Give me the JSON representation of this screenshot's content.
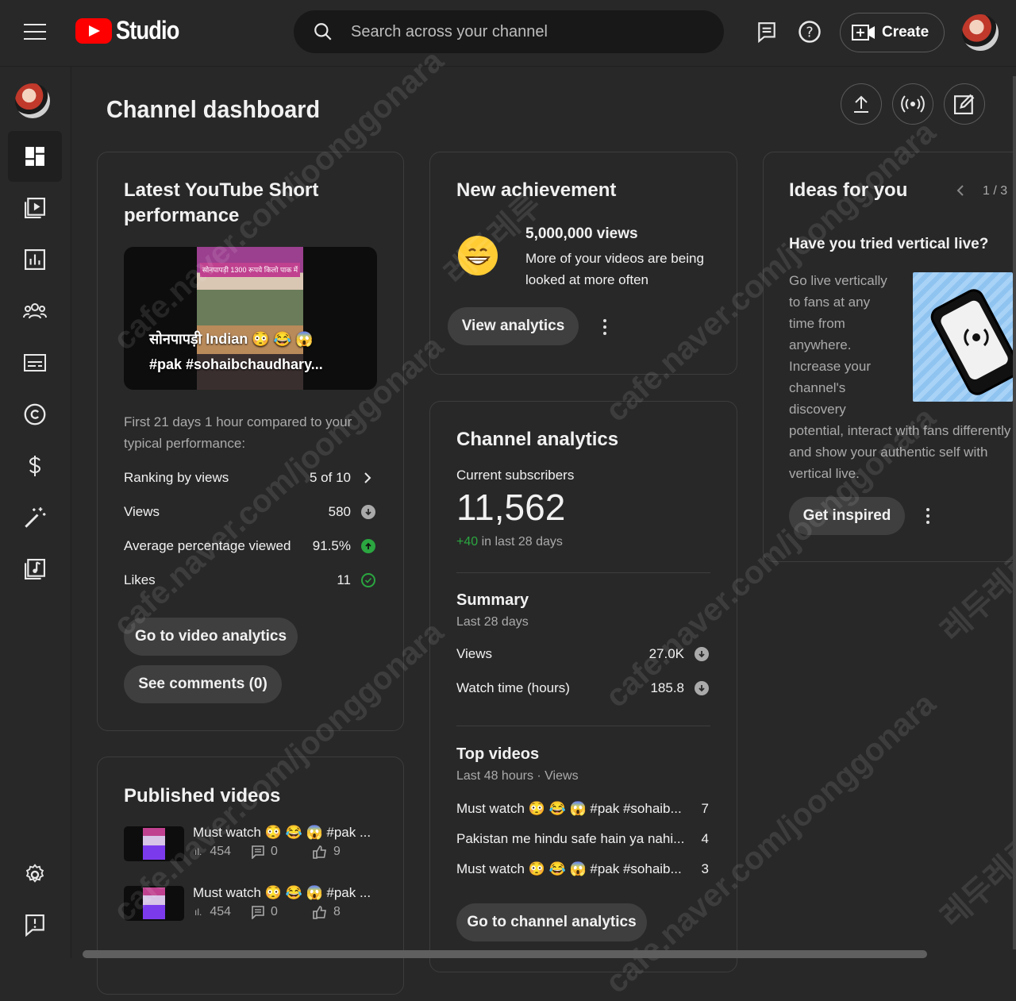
{
  "app": {
    "logo_text": "Studio"
  },
  "topbar": {
    "search_placeholder": "Search across your channel",
    "create_label": "Create"
  },
  "page": {
    "title": "Channel dashboard"
  },
  "short_card": {
    "title": "Latest YouTube Short performance",
    "thumb_band_text": "सोनपापड़ी 1300 रूपये किलो पाक में",
    "thumb_line1": "सोनपापड़ी Indian 😳 😂 😱",
    "thumb_line2": "#pak #sohaibchaudhary...",
    "comparison_text": "First 21 days 1 hour compared to your typical performance:",
    "rows": [
      {
        "label": "Ranking by views",
        "value": "5 of 10",
        "indicator": "chevron"
      },
      {
        "label": "Views",
        "value": "580",
        "indicator": "down-grey"
      },
      {
        "label": "Average percentage viewed",
        "value": "91.5%",
        "indicator": "up-green"
      },
      {
        "label": "Likes",
        "value": "11",
        "indicator": "check-green"
      }
    ],
    "btn_analytics": "Go to video analytics",
    "btn_comments": "See comments (0)"
  },
  "published": {
    "title": "Published videos",
    "items": [
      {
        "title": "Must watch 😳 😂 😱 #pak ...",
        "views": "454",
        "comments": "0",
        "likes": "9"
      },
      {
        "title": "Must watch 😳 😂 😱 #pak ...",
        "views": "454",
        "comments": "0",
        "likes": "8"
      }
    ]
  },
  "achievement": {
    "title": "New achievement",
    "milestone": "5,000,000 views",
    "description": "More of your videos are being looked at more often",
    "button": "View analytics"
  },
  "analytics": {
    "title": "Channel analytics",
    "subs_label": "Current subscribers",
    "subs_value": "11,562",
    "subs_delta": "+40",
    "subs_delta_suffix": "in last 28 days",
    "summary_title": "Summary",
    "summary_period": "Last 28 days",
    "summary_rows": [
      {
        "label": "Views",
        "value": "27.0K"
      },
      {
        "label": "Watch time (hours)",
        "value": "185.8"
      }
    ],
    "top_title": "Top videos",
    "top_period": "Last 48 hours · Views",
    "top_rows": [
      {
        "title": "Must watch 😳 😂 😱 #pak #sohaib...",
        "views": "7"
      },
      {
        "title": "Pakistan me hindu safe hain ya nahi...",
        "views": "4"
      },
      {
        "title": "Must watch 😳 😂 😱 #pak #sohaib...",
        "views": "3"
      }
    ],
    "button": "Go to channel analytics"
  },
  "ideas": {
    "title": "Ideas for you",
    "pager": "1 / 3",
    "headline": "Have you tried vertical live?",
    "body_lines": [
      "Go live vertically",
      "to fans at any",
      "time from",
      "anywhere.",
      "Increase your",
      "channel's",
      "discovery",
      "potential, interact with fans differently",
      "and show your authentic self with",
      "vertical live."
    ],
    "button": "Get inspired"
  },
  "watermarks": [
    "cafe.naver.com/joonggonara",
    "레두레루"
  ],
  "colors": {
    "accent_red": "#ff0000",
    "positive_green": "#2ba640",
    "bg": "#282828"
  }
}
